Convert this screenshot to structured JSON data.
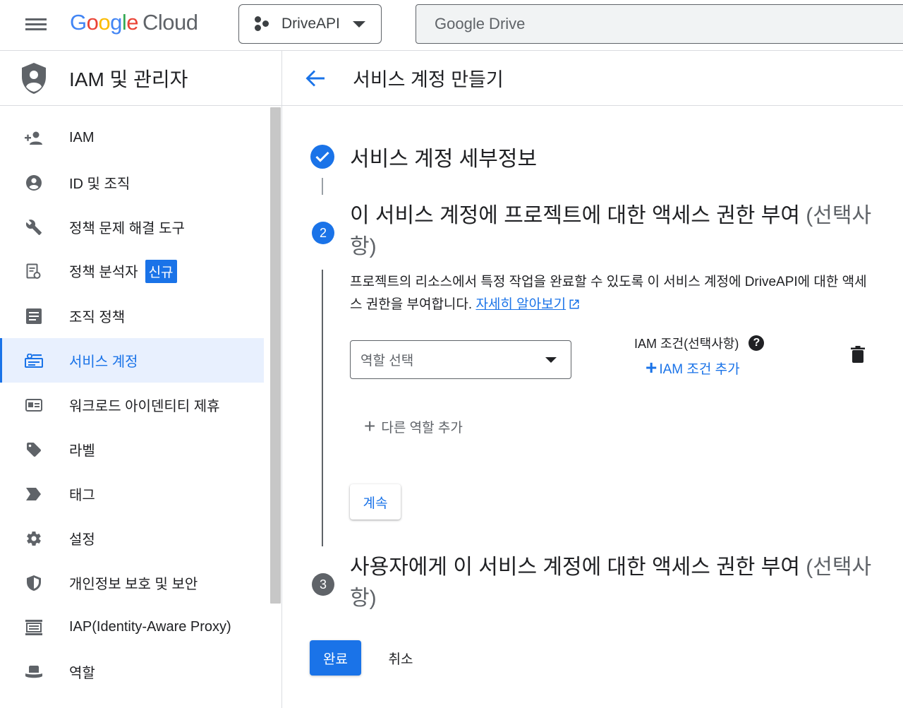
{
  "header": {
    "logo_google": [
      "G",
      "o",
      "o",
      "g",
      "l",
      "e"
    ],
    "logo_cloud": "Cloud",
    "project_name": "DriveAPI",
    "search_value": "Google Drive"
  },
  "sidebar": {
    "title": "IAM 및 관리자",
    "items": [
      {
        "label": "IAM",
        "icon": "add-person-icon"
      },
      {
        "label": "ID 및 조직",
        "icon": "account-circle-icon"
      },
      {
        "label": "정책 문제 해결 도구",
        "icon": "wrench-icon"
      },
      {
        "label": "정책 분석자",
        "icon": "policy-document-icon",
        "badge": "신규"
      },
      {
        "label": "조직 정책",
        "icon": "article-icon"
      },
      {
        "label": "서비스 계정",
        "icon": "service-account-icon",
        "active": true
      },
      {
        "label": "워크로드 아이덴티티 제휴",
        "icon": "id-card-icon"
      },
      {
        "label": "라벨",
        "icon": "tag-icon"
      },
      {
        "label": "태그",
        "icon": "label-arrow-icon"
      },
      {
        "label": "설정",
        "icon": "gear-icon"
      },
      {
        "label": "개인정보 보호 및 보안",
        "icon": "security-shield-icon"
      },
      {
        "label": "IAP(Identity-Aware Proxy)",
        "icon": "iap-icon"
      },
      {
        "label": "역할",
        "icon": "role-hat-icon"
      }
    ]
  },
  "main": {
    "title": "서비스 계정 만들기",
    "step1": {
      "title": "서비스 계정 세부정보"
    },
    "step2": {
      "number": "2",
      "title": "이 서비스 계정에 프로젝트에 대한 액세스 권한 부여",
      "optional": "(선택사항)",
      "description": "프로젝트의 리소스에서 특정 작업을 완료할 수 있도록 이 서비스 계정에 DriveAPI에 대한 액세스 권한을 부여합니다.",
      "learn_more": "자세히 알아보기",
      "role_placeholder": "역할 선택",
      "iam_condition_label": "IAM 조건(선택사항)",
      "add_condition": "IAM 조건 추가",
      "add_role": "다른 역할 추가",
      "continue": "계속"
    },
    "step3": {
      "number": "3",
      "title": "사용자에게 이 서비스 계정에 대한 액세스 권한 부여",
      "optional": "(선택사항)"
    },
    "done": "완료",
    "cancel": "취소"
  },
  "colors": {
    "accent": "#1a73e8",
    "active_bg": "#e8f0fe",
    "text": "#202124",
    "muted": "#5f6368"
  }
}
